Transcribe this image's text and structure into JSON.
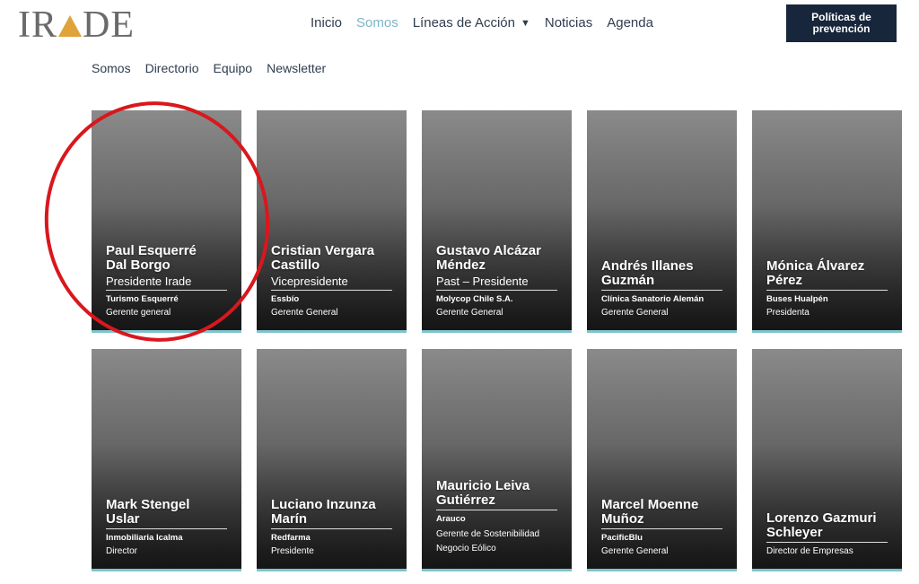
{
  "header": {
    "logo_text_left": "IR",
    "logo_text_right": "DE",
    "nav": [
      {
        "label": "Inicio",
        "active": false
      },
      {
        "label": "Somos",
        "active": true
      },
      {
        "label": "Líneas de Acción",
        "active": false,
        "dropdown": true
      },
      {
        "label": "Noticias",
        "active": false
      },
      {
        "label": "Agenda",
        "active": false
      }
    ],
    "cta_label": "Políticas de prevención"
  },
  "subnav": [
    "Somos",
    "Directorio",
    "Equipo",
    "Newsletter"
  ],
  "colors": {
    "accent": "#7fb5c8",
    "cta_bg": "#17263a",
    "card_underline": "#7fc3cc",
    "highlight_ring": "#d9171d"
  },
  "cards": [
    {
      "name": "Paul Esquerré\nDal Borgo",
      "role": "Presidente Irade",
      "company": "Turismo Esquerré",
      "position": "Gerente general"
    },
    {
      "name": "Cristian Vergara\nCastillo",
      "role": "Vicepresidente",
      "company": "Essbío",
      "position": "Gerente General"
    },
    {
      "name": "Gustavo Alcázar\nMéndez",
      "role": "Past – Presidente",
      "company": "Molycop Chile S.A.",
      "position": "Gerente General"
    },
    {
      "name": "Andrés Illanes\nGuzmán",
      "role": "",
      "company": "Clínica Sanatorio Alemán",
      "position": "Gerente General"
    },
    {
      "name": "Mónica Álvarez\nPérez",
      "role": "",
      "company": "Buses Hualpén",
      "position": "Presidenta"
    },
    {
      "name": "Mark Stengel\nUslar",
      "role": "",
      "company": "Inmobiliaria Icalma",
      "position": "Director"
    },
    {
      "name": "Luciano Inzunza\nMarín",
      "role": "",
      "company": "Redfarma",
      "position": "Presidente"
    },
    {
      "name": "Mauricio Leiva\nGutiérrez",
      "role": "",
      "company": "Arauco",
      "position": "Gerente de Sostenibilidad\nNegocio Eólico"
    },
    {
      "name": "Marcel Moenne\nMuñoz",
      "role": "",
      "company": "PacificBlu",
      "position": "Gerente General"
    },
    {
      "name": "Lorenzo Gazmuri\nSchleyer",
      "role": "",
      "company": "",
      "position": "Director de Empresas"
    }
  ]
}
